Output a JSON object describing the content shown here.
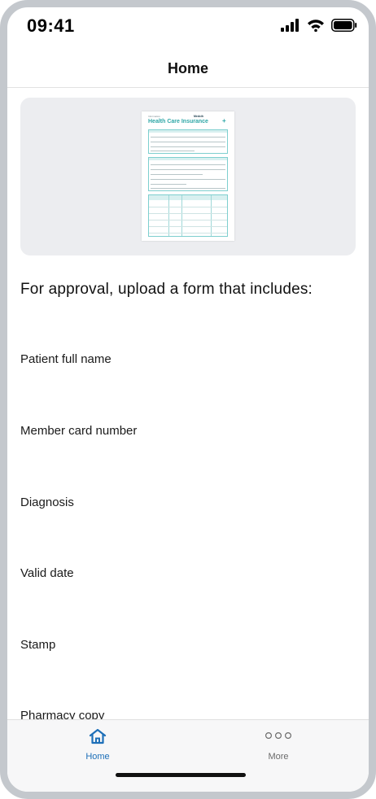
{
  "status_bar": {
    "time": "09:41"
  },
  "header": {
    "title": "Home"
  },
  "preview": {
    "document_subtitle": "Information",
    "document_brand": "Medcih",
    "document_title": "Health Care Insurance"
  },
  "main": {
    "intro": "For approval, upload a form that includes:",
    "requirements": [
      "Patient full name",
      "Member card number",
      "Diagnosis",
      "Valid date",
      "Stamp",
      "Pharmacy copy"
    ]
  },
  "tab_bar": {
    "tabs": [
      {
        "label": "Home",
        "icon": "home-icon",
        "active": true
      },
      {
        "label": "More",
        "icon": "more-icon",
        "active": false
      }
    ]
  },
  "colors": {
    "accent": "#1d6fb8",
    "doc_accent": "#2fa7a7"
  }
}
